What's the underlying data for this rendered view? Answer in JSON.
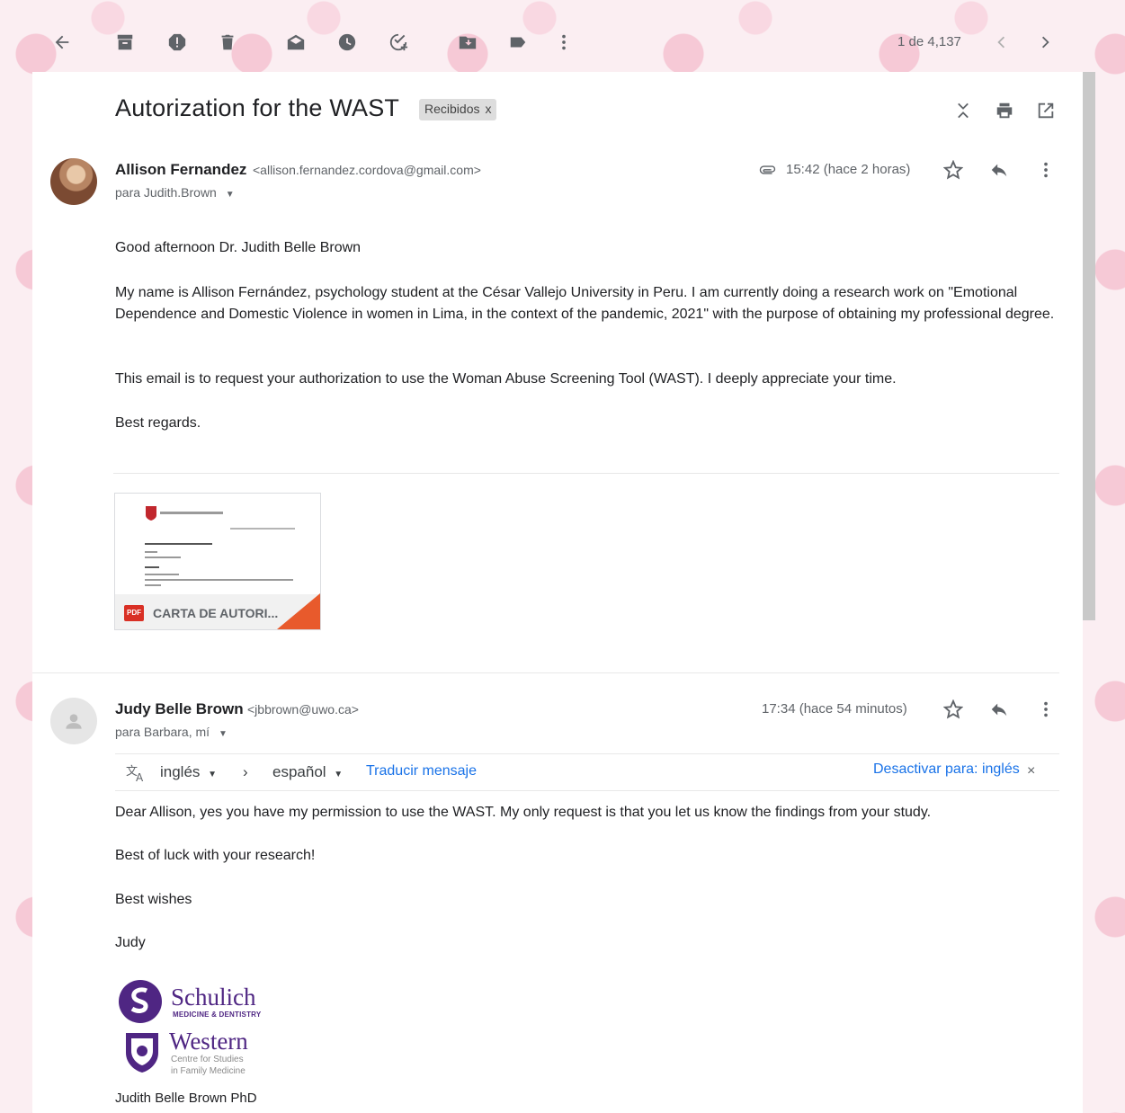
{
  "toolbar": {
    "pager": "1 de 4,137"
  },
  "subject": {
    "title": "Autorization for the WAST",
    "label": "Recibidos",
    "label_close": "x"
  },
  "message1": {
    "sender_name": "Allison Fernandez",
    "sender_email": "<allison.fernandez.cordova@gmail.com>",
    "to": "para Judith.Brown",
    "time": "15:42 (hace 2 horas)",
    "greeting": "Good afternoon Dr. Judith Belle Brown",
    "para1": "My name is Allison Fernández, psychology student at the César Vallejo University in Peru. I am currently doing a research work on \"Emotional Dependence and Domestic Violence in women in Lima, in the context of the pandemic, 2021\" with the purpose of obtaining my professional degree.",
    "para2": "This email is to request your authorization to use the Woman Abuse Screening Tool (WAST). I deeply appreciate your time.",
    "closing": "Best regards.",
    "attachment": {
      "name": "CARTA DE AUTORI...",
      "badge": "PDF"
    }
  },
  "message2": {
    "sender_name": "Judy Belle Brown",
    "sender_email": "<jbbrown@uwo.ca>",
    "to": "para Barbara, mí",
    "time": "17:34 (hace 54 minutos)",
    "translate": {
      "from_lang": "inglés",
      "to_lang": "español",
      "translate_link": "Traducir mensaje",
      "disable_link": "Desactivar para: inglés",
      "close": "×"
    },
    "para1": "Dear Allison, yes you have my permission to use the WAST. My only request is that you let us know the findings from your study.",
    "para2": "Best of luck with your research!",
    "para3": "Best wishes",
    "para4": "Judy",
    "logo1_name": "Schulich",
    "logo1_sub": "MEDICINE & DENTISTRY",
    "logo2_name": "Western",
    "logo2_sub1": "Centre for Studies",
    "logo2_sub2": "in Family Medicine",
    "signature": "Judith Belle Brown PhD"
  },
  "colors": {
    "link": "#1a73e8",
    "pdf_red": "#d93025",
    "schulich_purple": "#4f2683"
  }
}
